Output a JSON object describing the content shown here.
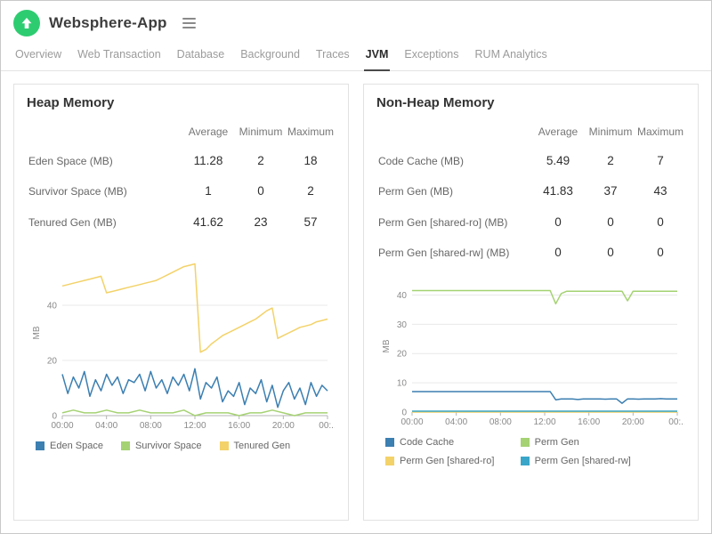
{
  "header": {
    "title": "Websphere-App"
  },
  "tabs": [
    {
      "label": "Overview",
      "active": false
    },
    {
      "label": "Web Transaction",
      "active": false
    },
    {
      "label": "Database",
      "active": false
    },
    {
      "label": "Background",
      "active": false
    },
    {
      "label": "Traces",
      "active": false
    },
    {
      "label": "JVM",
      "active": true
    },
    {
      "label": "Exceptions",
      "active": false
    },
    {
      "label": "RUM Analytics",
      "active": false
    }
  ],
  "colors": {
    "status_green": "#2ecc71",
    "series_blue": "#3c7fb1",
    "series_green": "#a5d273",
    "series_yellow": "#f3d269",
    "series_teal": "#39a6c9"
  },
  "panels": [
    {
      "title": "Heap Memory",
      "table": {
        "columns": [
          "Average",
          "Minimum",
          "Maximum"
        ],
        "rows": [
          {
            "label": "Eden Space (MB)",
            "values": [
              "11.28",
              "2",
              "18"
            ]
          },
          {
            "label": "Survivor Space (MB)",
            "values": [
              "1",
              "0",
              "2"
            ]
          },
          {
            "label": "Tenured Gen (MB)",
            "values": [
              "41.62",
              "23",
              "57"
            ]
          }
        ]
      },
      "chart_data": {
        "type": "line",
        "ylabel": "MB",
        "ylim": [
          0,
          60
        ],
        "yticks": [
          0,
          20,
          40
        ],
        "xticks": [
          "00:00",
          "04:00",
          "08:00",
          "12:00",
          "16:00",
          "20:00",
          "00:.."
        ],
        "series": [
          {
            "name": "Eden Space",
            "color": "#3c7fb1",
            "values": [
              15,
              8,
              14,
              10,
              16,
              7,
              13,
              9,
              15,
              11,
              14,
              8,
              13,
              12,
              15,
              9,
              16,
              10,
              13,
              8,
              14,
              11,
              15,
              9,
              17,
              6,
              12,
              10,
              14,
              5,
              9,
              7,
              12,
              4,
              10,
              8,
              13,
              5,
              11,
              3,
              9,
              12,
              6,
              10,
              4,
              12,
              7,
              11,
              9
            ]
          },
          {
            "name": "Survivor Space",
            "color": "#a5d273",
            "values": [
              1,
              2,
              1,
              1,
              2,
              1,
              1,
              2,
              1,
              1,
              1,
              2,
              0,
              1,
              1,
              1,
              0,
              1,
              1,
              2,
              1,
              0,
              1,
              1,
              1
            ]
          },
          {
            "name": "Tenured Gen",
            "color": "#f3d269",
            "values": [
              47,
              47.5,
              48,
              48.5,
              49,
              49.5,
              50,
              50.5,
              44.5,
              45,
              45.5,
              46,
              46.5,
              47,
              47.5,
              48,
              48.5,
              49,
              50,
              51,
              52,
              53,
              54,
              54.5,
              55,
              23,
              24,
              26,
              27.5,
              29,
              30,
              31,
              32,
              33,
              34,
              35,
              36.5,
              38,
              39,
              28,
              29,
              30,
              31,
              32,
              32.5,
              33,
              34,
              34.5,
              35
            ]
          }
        ]
      }
    },
    {
      "title": "Non-Heap Memory",
      "table": {
        "columns": [
          "Average",
          "Minimum",
          "Maximum"
        ],
        "rows": [
          {
            "label": "Code Cache (MB)",
            "values": [
              "5.49",
              "2",
              "7"
            ]
          },
          {
            "label": "Perm Gen (MB)",
            "values": [
              "41.83",
              "37",
              "43"
            ]
          },
          {
            "label": "Perm Gen [shared-ro] (MB)",
            "values": [
              "0",
              "0",
              "0"
            ]
          },
          {
            "label": "Perm Gen [shared-rw] (MB)",
            "values": [
              "0",
              "0",
              "0"
            ]
          }
        ]
      },
      "chart_data": {
        "type": "line",
        "ylabel": "MB",
        "ylim": [
          0,
          45
        ],
        "yticks": [
          0,
          10,
          20,
          30,
          40
        ],
        "xticks": [
          "00:00",
          "04:00",
          "08:00",
          "12:00",
          "16:00",
          "20:00",
          "00:.."
        ],
        "series": [
          {
            "name": "Code Cache",
            "color": "#3c7fb1",
            "values": [
              7,
              7,
              7,
              7,
              7,
              7,
              7,
              7,
              7,
              7,
              7,
              7,
              7,
              7,
              7,
              7,
              7,
              7,
              7,
              7,
              7,
              7,
              7,
              7,
              7,
              7,
              4.2,
              4.5,
              4.5,
              4.5,
              4.3,
              4.5,
              4.5,
              4.5,
              4.5,
              4.4,
              4.5,
              4.5,
              3,
              4.5,
              4.5,
              4.4,
              4.5,
              4.5,
              4.5,
              4.6,
              4.5,
              4.5,
              4.5
            ]
          },
          {
            "name": "Perm Gen",
            "color": "#a5d273",
            "values": [
              41.5,
              41.5,
              41.5,
              41.5,
              41.5,
              41.5,
              41.5,
              41.5,
              41.5,
              41.5,
              41.5,
              41.5,
              41.5,
              41.5,
              41.5,
              41.5,
              41.5,
              41.5,
              41.5,
              41.5,
              41.5,
              41.5,
              41.5,
              41.5,
              41.5,
              41.5,
              37,
              40.5,
              41.3,
              41.3,
              41.3,
              41.3,
              41.3,
              41.3,
              41.3,
              41.3,
              41.3,
              41.3,
              41.3,
              38,
              41.3,
              41.3,
              41.3,
              41.3,
              41.3,
              41.3,
              41.3,
              41.3,
              41.3
            ]
          },
          {
            "name": "Perm Gen [shared-ro]",
            "color": "#f3d269",
            "values": [
              0,
              0
            ]
          },
          {
            "name": "Perm Gen [shared-rw]",
            "color": "#39a6c9",
            "values": [
              0.3,
              0.3
            ]
          }
        ]
      }
    }
  ]
}
